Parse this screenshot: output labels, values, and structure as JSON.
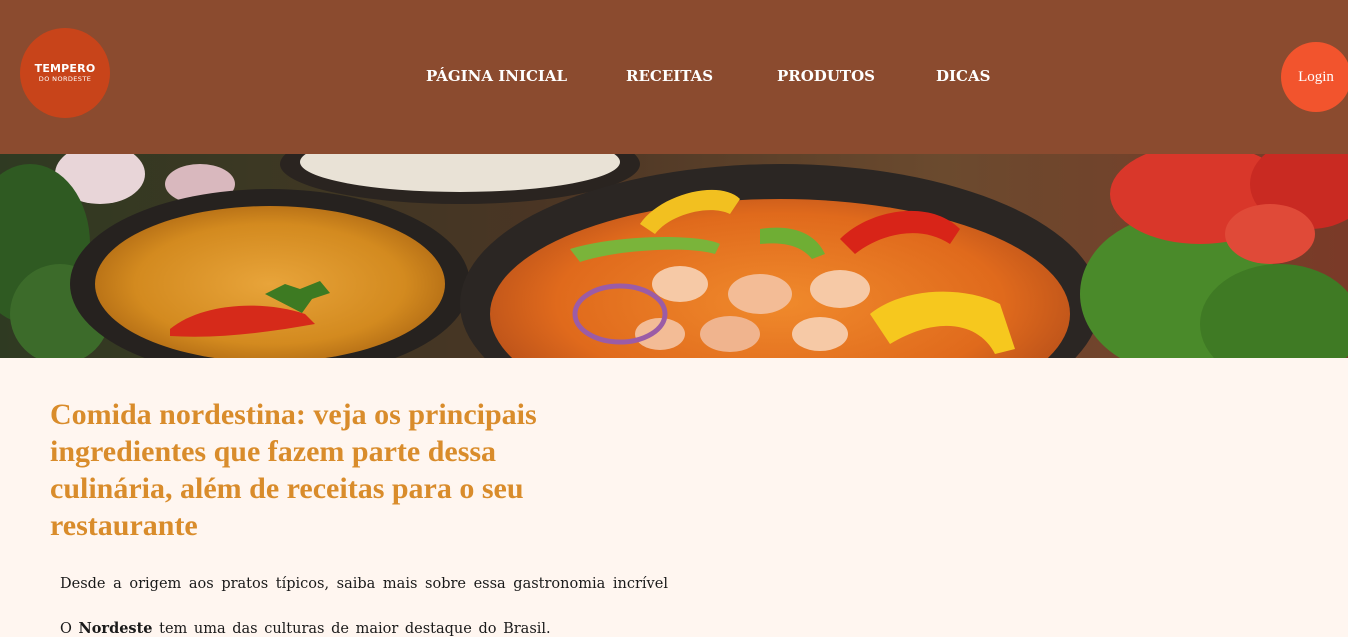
{
  "header": {
    "logo": {
      "line1": "TEMPERO",
      "line2": "DO NORDESTE"
    },
    "nav": [
      {
        "label": "PÁGINA INICIAL"
      },
      {
        "label": "RECEITAS"
      },
      {
        "label": "PRODUTOS"
      },
      {
        "label": "DICAS"
      }
    ],
    "login_label": "Login"
  },
  "hero": {
    "image": "nordeste-food-banner"
  },
  "article": {
    "title": "Comida nordestina: veja os principais ingredientes que fazem parte dessa culinária, além de receitas para o seu restaurante",
    "subtitle": "Desde a origem aos pratos típicos, saiba mais sobre essa gastronomia incrível",
    "para_prefix": "O ",
    "para_bold": "Nordeste",
    "para_rest": " tem uma das culturas de maior destaque do Brasil."
  },
  "colors": {
    "header_bg": "#8b4b2f",
    "logo_bg": "#c8441a",
    "login_bg": "#f2542d",
    "title": "#d98c2b",
    "page_bg": "#fff6f0"
  }
}
